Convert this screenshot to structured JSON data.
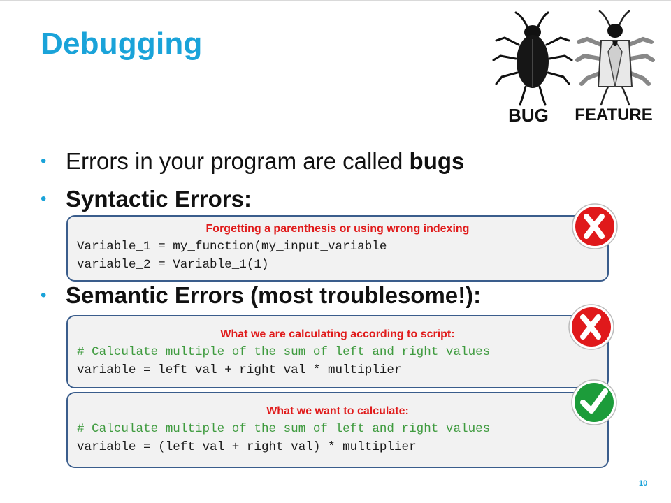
{
  "slide": {
    "title": "Debugging",
    "page_number": "10"
  },
  "illustration": {
    "bug_label": "BUG",
    "feature_label": "FEATURE"
  },
  "bullets": [
    {
      "text_before": "Errors in your program are called ",
      "bold": "bugs"
    },
    {
      "bold": "Syntactic Errors:"
    },
    {
      "bold": "Semantic Errors (most troublesome!):"
    }
  ],
  "boxes": {
    "syntactic": {
      "caption": "Forgetting a parenthesis or using wrong indexing",
      "lines": [
        "Variable_1 = my_function(my_input_variable",
        "variable_2 = Variable_1(1)"
      ],
      "badge": "cross-mark-icon"
    },
    "semantic_wrong": {
      "caption": "What we are calculating according to script:",
      "comment": "# Calculate multiple of the sum of left and right values",
      "code": "variable = left_val + right_val * multiplier",
      "badge": "cross-mark-icon"
    },
    "semantic_right": {
      "caption": "What we want to calculate:",
      "comment": "# Calculate multiple of the sum of left and right values",
      "code": "variable = (left_val + right_val) * multiplier",
      "badge": "check-mark-icon"
    }
  },
  "colors": {
    "title": "#1aa3d9",
    "caption": "#e01b1b",
    "comment": "#3f9b3f",
    "box_border": "#3a5d8c",
    "box_fill": "#f2f2f2",
    "cross_badge": "#e0191b",
    "check_badge": "#1c9c3a"
  }
}
